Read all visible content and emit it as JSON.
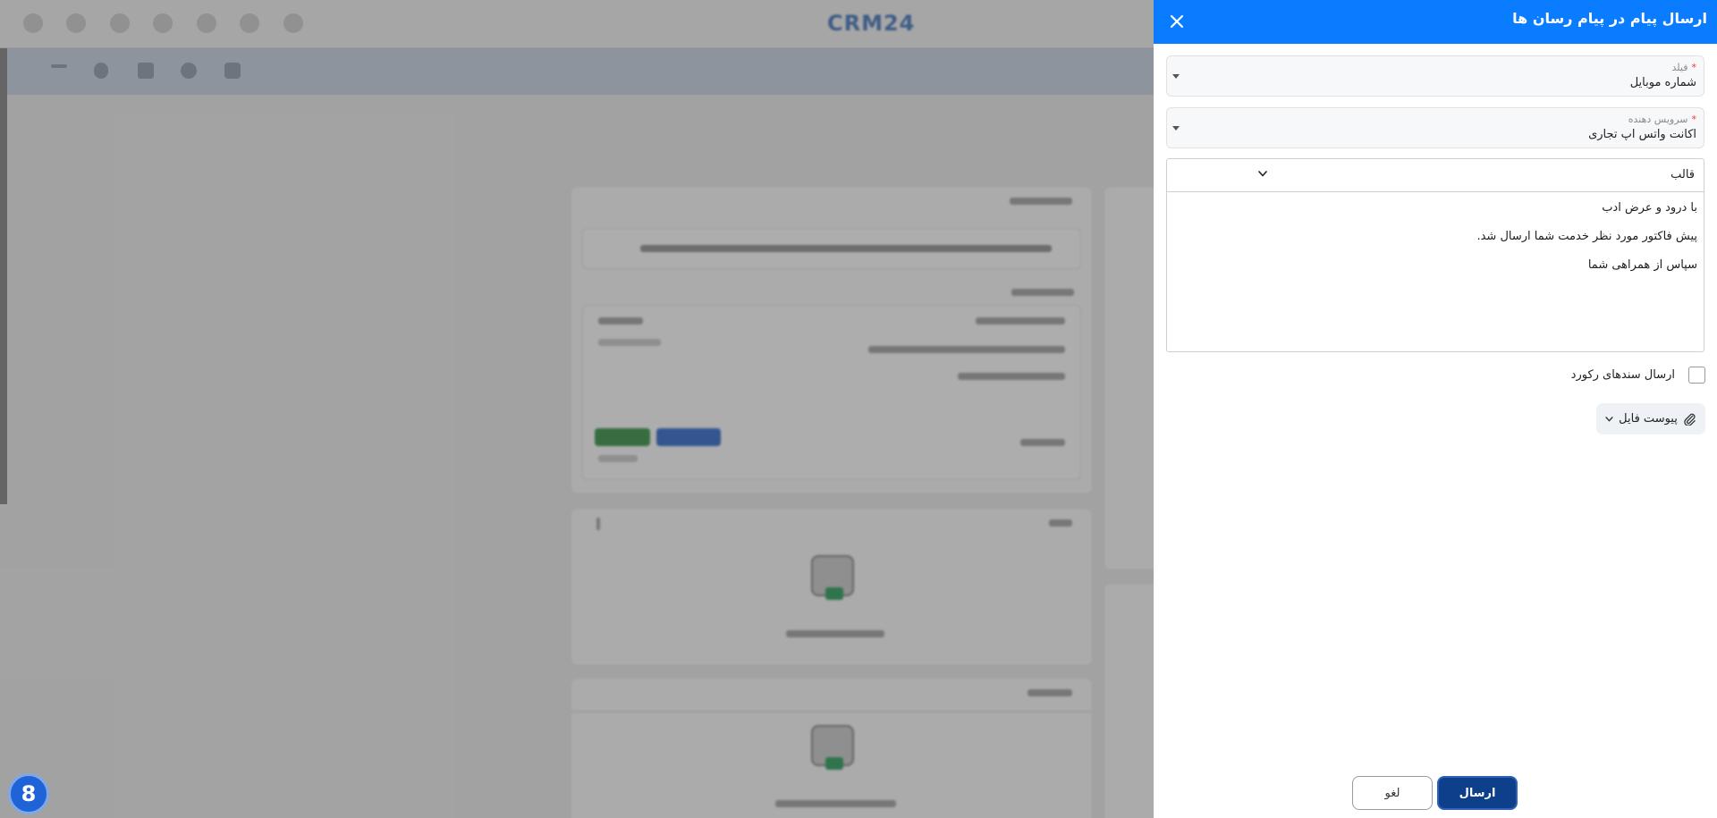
{
  "background": {
    "logo_text": "CRM24",
    "help_button_label": "8"
  },
  "panel": {
    "title": "ارسال پیام در پیام رسان ها",
    "field": {
      "label": "فیلد",
      "required_mark": "*",
      "value": "شماره موبایل"
    },
    "provider": {
      "label": "سرویس دهنده",
      "required_mark": "*",
      "value": "اکانت واتس اپ تجاری"
    },
    "template": {
      "label": "قالب",
      "lines": [
        "با درود و عرض ادب",
        "پیش فاکتور مورد نظر خدمت شما ارسال شد.",
        "سپاس از همراهی شما"
      ]
    },
    "send_record_documents": {
      "label": "ارسال سندهای رکورد",
      "checked": false
    },
    "attach_file_label": "پیوست فایل",
    "send_button_label": "ارسال",
    "cancel_button_label": "لغو"
  },
  "colors": {
    "header_blue": "#0a7cff",
    "primary_button": "#0e3f8a",
    "required_red": "#e53935"
  },
  "icons": {
    "close": "close-icon",
    "dropdown": "chevron-down-icon",
    "attach": "paperclip-icon"
  }
}
